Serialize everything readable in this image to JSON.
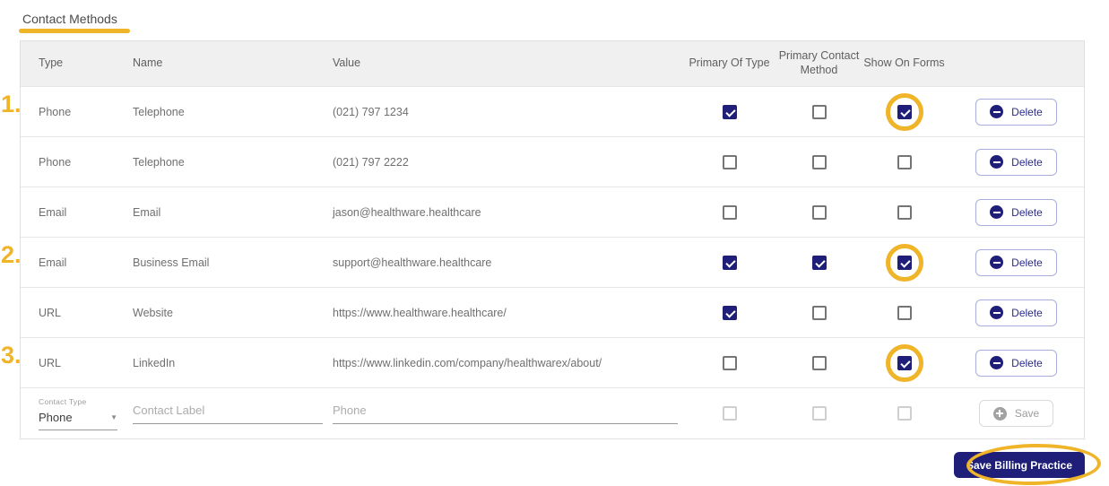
{
  "page": {
    "title": "Contact Methods"
  },
  "colors": {
    "accent_navy": "#1f1f7a",
    "annotation_yellow": "#f0b429",
    "delete_button_outline": "#a9aede",
    "header_background": "#f0f0f0"
  },
  "table": {
    "columns": [
      "Type",
      "Name",
      "Value",
      "Primary Of Type",
      "Primary Contact Method",
      "Show On Forms",
      ""
    ],
    "delete_label": "Delete",
    "rows": [
      {
        "type": "Phone",
        "name": "Telephone",
        "value": "(021) 797 1234",
        "primary_of_type": true,
        "primary_contact_method": false,
        "show_on_forms": true,
        "annotation_number": "1.",
        "annotation_circle_show_on_forms": true
      },
      {
        "type": "Phone",
        "name": "Telephone",
        "value": "(021) 797 2222",
        "primary_of_type": false,
        "primary_contact_method": false,
        "show_on_forms": false,
        "annotation_number": null,
        "annotation_circle_show_on_forms": false
      },
      {
        "type": "Email",
        "name": "Email",
        "value": "jason@healthware.healthcare",
        "primary_of_type": false,
        "primary_contact_method": false,
        "show_on_forms": false,
        "annotation_number": null,
        "annotation_circle_show_on_forms": false
      },
      {
        "type": "Email",
        "name": "Business Email",
        "value": "support@healthware.healthcare",
        "primary_of_type": true,
        "primary_contact_method": true,
        "show_on_forms": true,
        "annotation_number": "2.",
        "annotation_circle_show_on_forms": true
      },
      {
        "type": "URL",
        "name": "Website",
        "value": "https://www.healthware.healthcare/",
        "primary_of_type": true,
        "primary_contact_method": false,
        "show_on_forms": false,
        "annotation_number": null,
        "annotation_circle_show_on_forms": false
      },
      {
        "type": "URL",
        "name": "LinkedIn",
        "value": "https://www.linkedin.com/company/healthwarex/about/",
        "primary_of_type": false,
        "primary_contact_method": false,
        "show_on_forms": true,
        "annotation_number": "3.",
        "annotation_circle_show_on_forms": true
      }
    ]
  },
  "form_row": {
    "contact_type_label": "Contact Type",
    "contact_type_value": "Phone",
    "contact_label_placeholder": "Contact Label",
    "value_placeholder": "Phone",
    "save_label": "Save"
  },
  "footer": {
    "save_button_label": "Save Billing Practice"
  }
}
